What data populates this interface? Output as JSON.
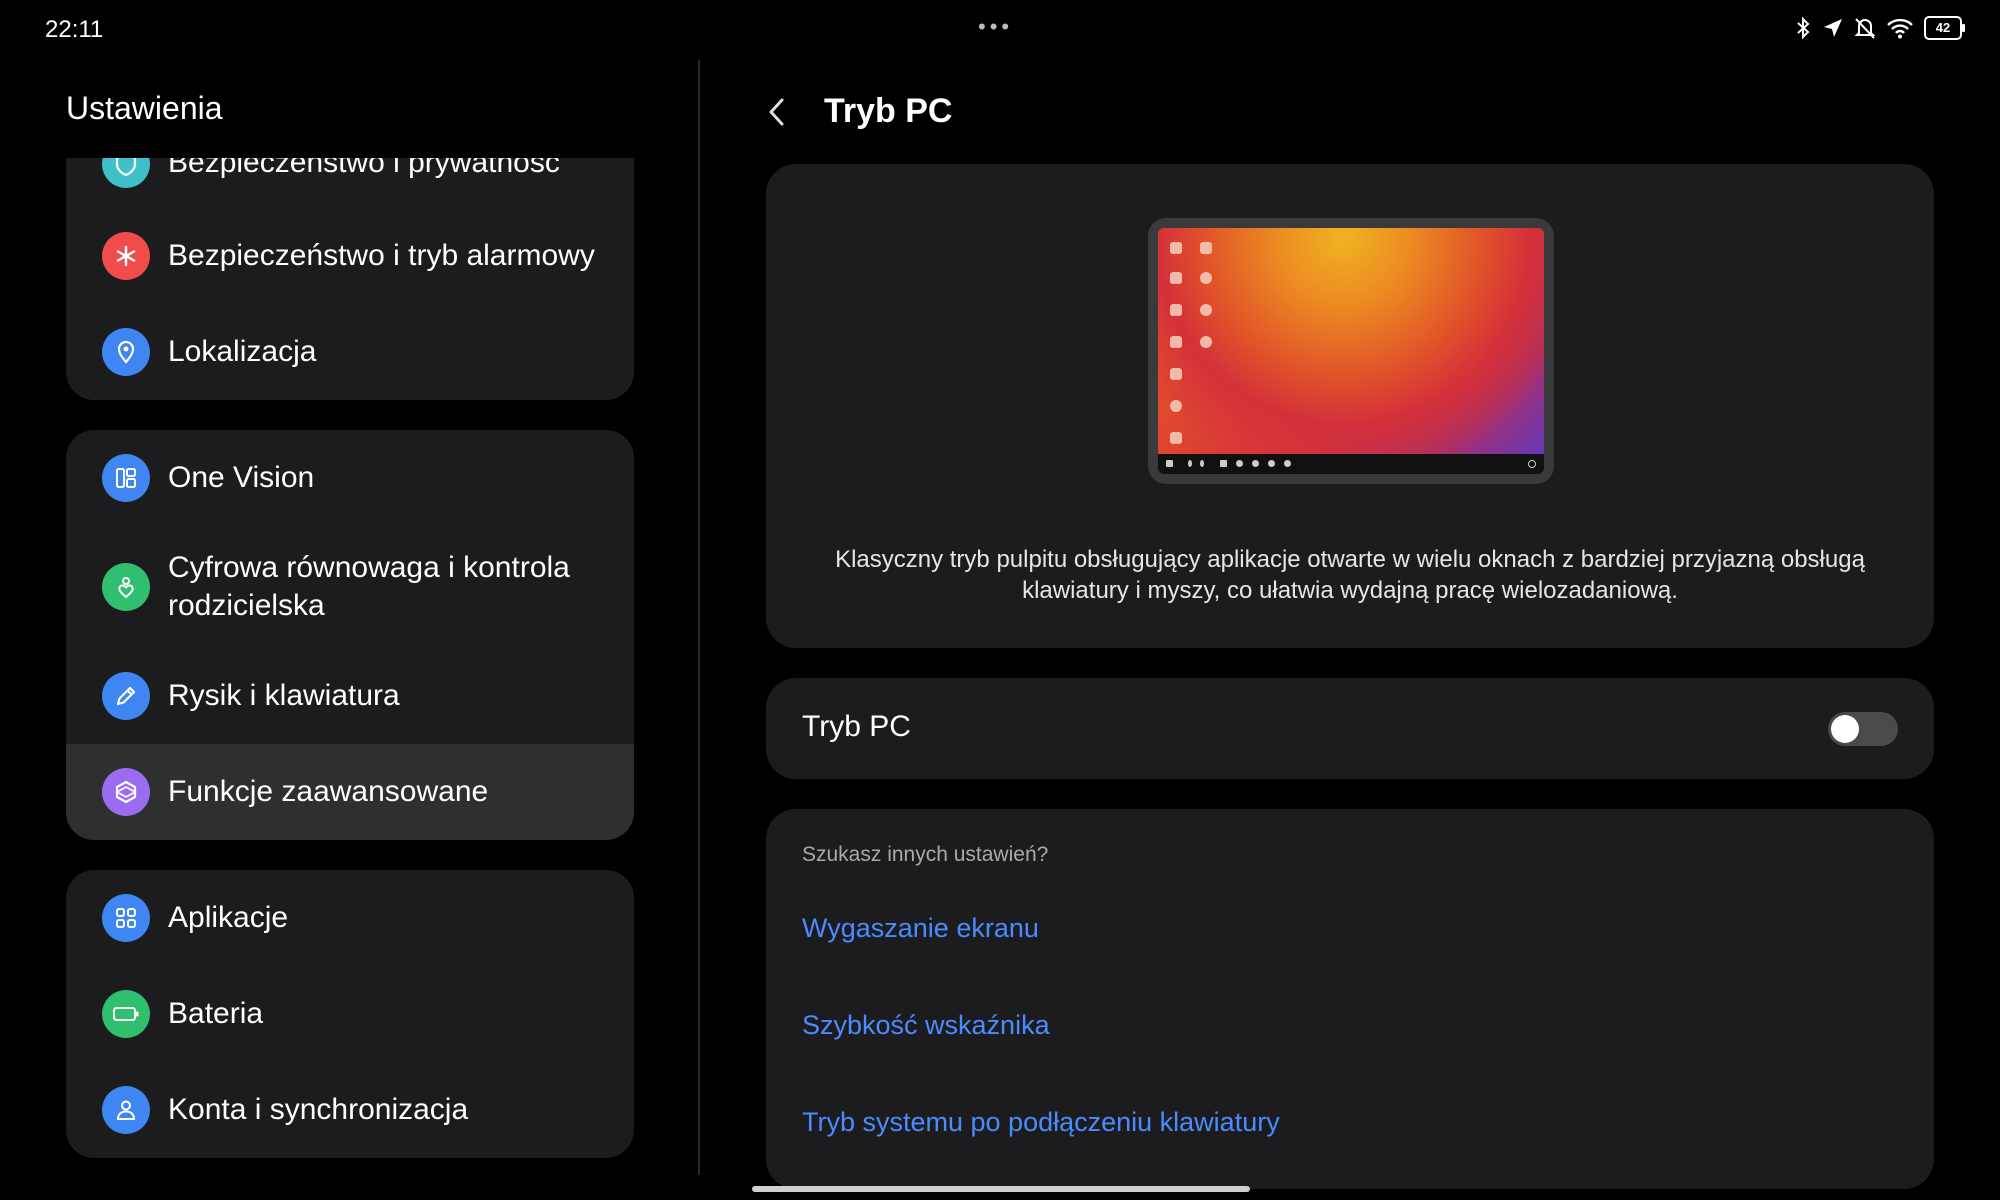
{
  "status_bar": {
    "time": "22:11",
    "battery": "42",
    "icons": [
      "bluetooth-icon",
      "location-icon",
      "mute-icon",
      "wifi-icon",
      "battery-icon"
    ]
  },
  "sidebar": {
    "title": "Ustawienia",
    "groups": [
      {
        "items": [
          {
            "label": "Bezpieczeństwo i prywatność",
            "icon": "shield-icon",
            "color": "#3fbfc8"
          },
          {
            "label": "Bezpieczeństwo i tryb alarmowy",
            "icon": "asterisk-icon",
            "color": "#f04c4c"
          },
          {
            "label": "Lokalizacja",
            "icon": "location-pin-icon",
            "color": "#3f86f2"
          }
        ]
      },
      {
        "items": [
          {
            "label": "One Vision",
            "icon": "layout-icon",
            "color": "#3f86f2"
          },
          {
            "label": "Cyfrowa równowaga i kontrola rodzicielska",
            "icon": "heart-person-icon",
            "color": "#2fbf6f"
          },
          {
            "label": "Rysik i klawiatura",
            "icon": "pen-icon",
            "color": "#3f86f2"
          },
          {
            "label": "Funkcje zaawansowane",
            "icon": "hexagon-icon",
            "color": "#9a6cf0"
          }
        ]
      },
      {
        "items": [
          {
            "label": "Aplikacje",
            "icon": "apps-grid-icon",
            "color": "#3f86f2"
          },
          {
            "label": "Bateria",
            "icon": "battery-outline-icon",
            "color": "#2fbf6f"
          },
          {
            "label": "Konta i synchronizacja",
            "icon": "person-icon",
            "color": "#3f86f2"
          }
        ]
      }
    ]
  },
  "main": {
    "title": "Tryb PC",
    "description": "Klasyczny tryb pulpitu obsługujący aplikacje otwarte w wielu oknach z bardziej przyjazną obsługą klawiatury i myszy, co ułatwia wydajną pracę wielozadaniową.",
    "toggle": {
      "label": "Tryb PC",
      "on": false
    },
    "related": {
      "header": "Szukasz innych ustawień?",
      "links": [
        "Wygaszanie ekranu",
        "Szybkość wskaźnika",
        "Tryb systemu po podłączeniu klawiatury"
      ]
    }
  },
  "colors": {
    "accent_link": "#4a8cff",
    "card_bg": "#1c1c1e",
    "background": "#000000"
  }
}
